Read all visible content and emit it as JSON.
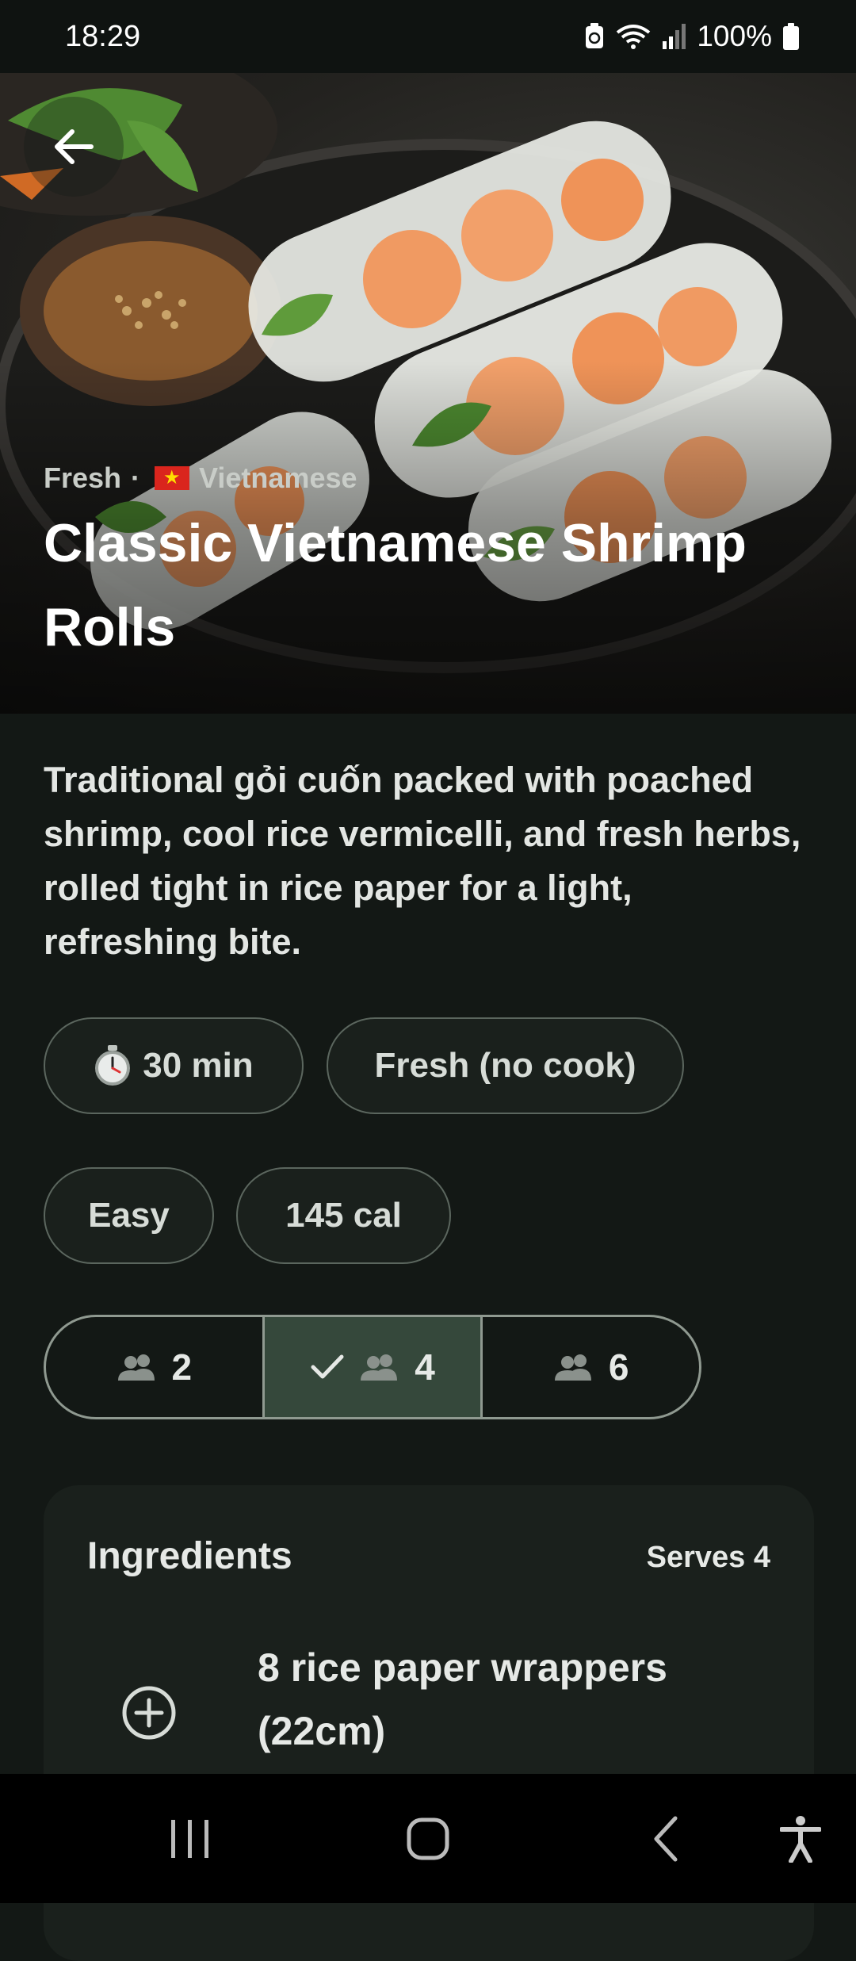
{
  "status_bar": {
    "time": "18:29",
    "battery": "100%"
  },
  "hero": {
    "category": "Fresh",
    "separator": "·",
    "cuisine": "Vietnamese",
    "flag_icon": "vietnam-flag-icon",
    "title": "Classic Vietnamese Shrimp Rolls"
  },
  "description": "Traditional gỏi cuốn packed with poached shrimp, cool rice vermicelli, and fresh herbs, rolled tight in rice paper for a light, refreshing bite.",
  "chips": {
    "time": "30 min",
    "method": "Fresh (no cook)",
    "difficulty": "Easy",
    "calories": "145 cal"
  },
  "servings": {
    "options": [
      "2",
      "4",
      "6"
    ],
    "selected": "4"
  },
  "ingredients": {
    "title": "Ingredients",
    "serves": "Serves 4",
    "items": [
      {
        "text": "8 rice paper wrappers (22cm)"
      }
    ]
  },
  "colors": {
    "background": "#131815",
    "card": "#1a201c",
    "selected_segment": "#35483b"
  }
}
